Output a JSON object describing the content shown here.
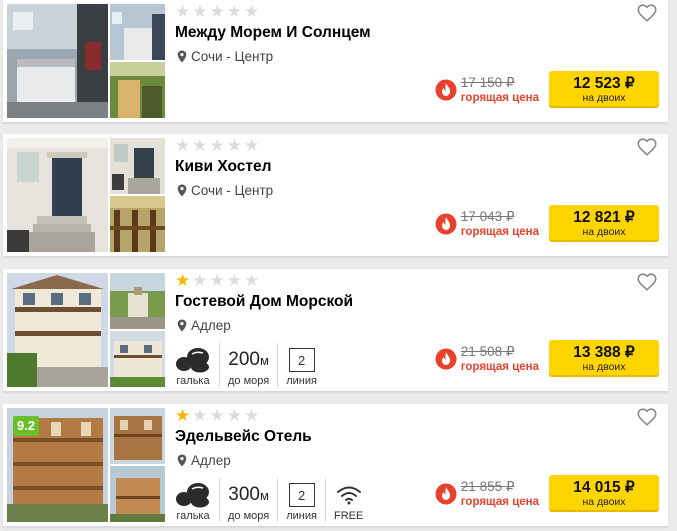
{
  "currency_symbol": "₽",
  "hotels": [
    {
      "name": "Между Морем И Солнцем",
      "stars": 0,
      "location": "Сочи - Центр",
      "old_price": "17 150 ₽",
      "hot_label": "горящая цена",
      "price": "12 523 ₽",
      "price_sub": "на двоих"
    },
    {
      "name": "Киви Хостел",
      "stars": 0,
      "location": "Сочи - Центр",
      "old_price": "17 043 ₽",
      "hot_label": "горящая цена",
      "price": "12 821 ₽",
      "price_sub": "на двоих"
    },
    {
      "name": "Гостевой Дом Морской",
      "stars": 1,
      "location": "Адлер",
      "beach_label": "галька",
      "distance_value": "200",
      "distance_unit": "м",
      "distance_label": "до моря",
      "line_value": "2",
      "line_label": "линия",
      "old_price": "21 508 ₽",
      "hot_label": "горящая цена",
      "price": "13 388 ₽",
      "price_sub": "на двоих"
    },
    {
      "name": "Эдельвейс Отель",
      "score": "9.2",
      "stars": 1,
      "location": "Адлер",
      "beach_label": "галька",
      "distance_value": "300",
      "distance_unit": "м",
      "distance_label": "до моря",
      "line_value": "2",
      "line_label": "линия",
      "wifi_label": "FREE",
      "old_price": "21 855 ₽",
      "hot_label": "горящая цена",
      "price": "14 015 ₽",
      "price_sub": "на двоих"
    }
  ],
  "colors": {
    "accent_yellow": "#ffd500",
    "hot_red": "#e8412c",
    "star_on": "#f7b500",
    "star_off": "#dcdcdc",
    "score_green": "#6bbf2b"
  },
  "icons": [
    "heart-icon",
    "location-pin-icon",
    "fire-icon",
    "pebbles-icon",
    "wifi-icon",
    "star-icon"
  ]
}
